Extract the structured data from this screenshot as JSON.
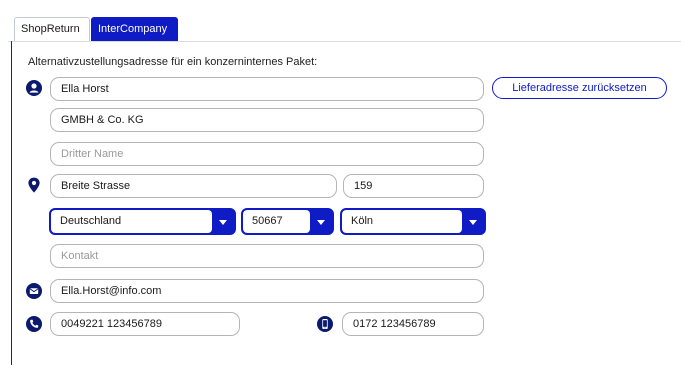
{
  "tabs": [
    {
      "label": "ShopReturn",
      "active": false
    },
    {
      "label": "InterCompany",
      "active": true
    }
  ],
  "form": {
    "heading": "Alternativzustellungsadresse für ein konzerninternes Paket:",
    "name": "Ella Horst",
    "company": "GMBH & Co. KG",
    "third_name_placeholder": "Dritter Name",
    "street": "Breite Strasse",
    "house_number": "159",
    "country": "Deutschland",
    "postal_code": "50667",
    "city": "Köln",
    "contact_placeholder": "Kontakt",
    "email": "Ella.Horst@info.com",
    "phone": "0049221 123456789",
    "mobile": "0172 123456789"
  },
  "actions": {
    "reset_label": "Lieferadresse zurücksetzen"
  },
  "icons": {
    "name": "person-icon",
    "address": "location-pin-icon",
    "email": "envelope-icon",
    "phone": "phone-icon",
    "mobile": "mobile-phone-icon",
    "dropdown": "chevron-down-icon"
  },
  "colors": {
    "accent": "#0f1bc4",
    "icon": "#0a1a6e"
  }
}
